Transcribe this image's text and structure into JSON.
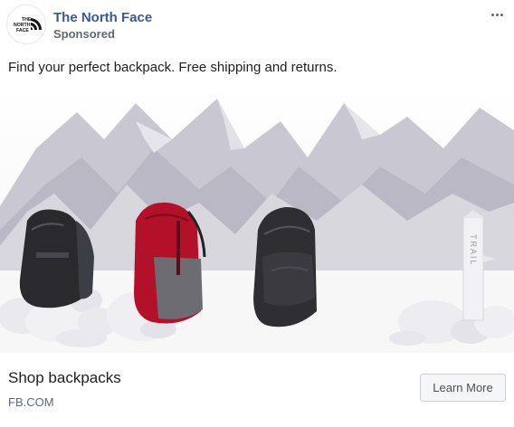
{
  "post": {
    "page_name": "The North Face",
    "sponsored_label": "Sponsored",
    "caption": "Find your perfect backpack. Free shipping and returns.",
    "more_icon": "ellipsis-horizontal-icon"
  },
  "logo": {
    "line1": "THE",
    "line2": "NORTH",
    "line3": "FACE"
  },
  "media": {
    "trail_marker_text": "TRAIL"
  },
  "cta": {
    "title": "Shop backpacks",
    "domain": "FB.COM",
    "button_label": "Learn More"
  },
  "colors": {
    "page_name": "#385898",
    "secondary_text": "#606770",
    "button_bg": "#f5f6f7",
    "backpack_red": "#b3112a"
  }
}
